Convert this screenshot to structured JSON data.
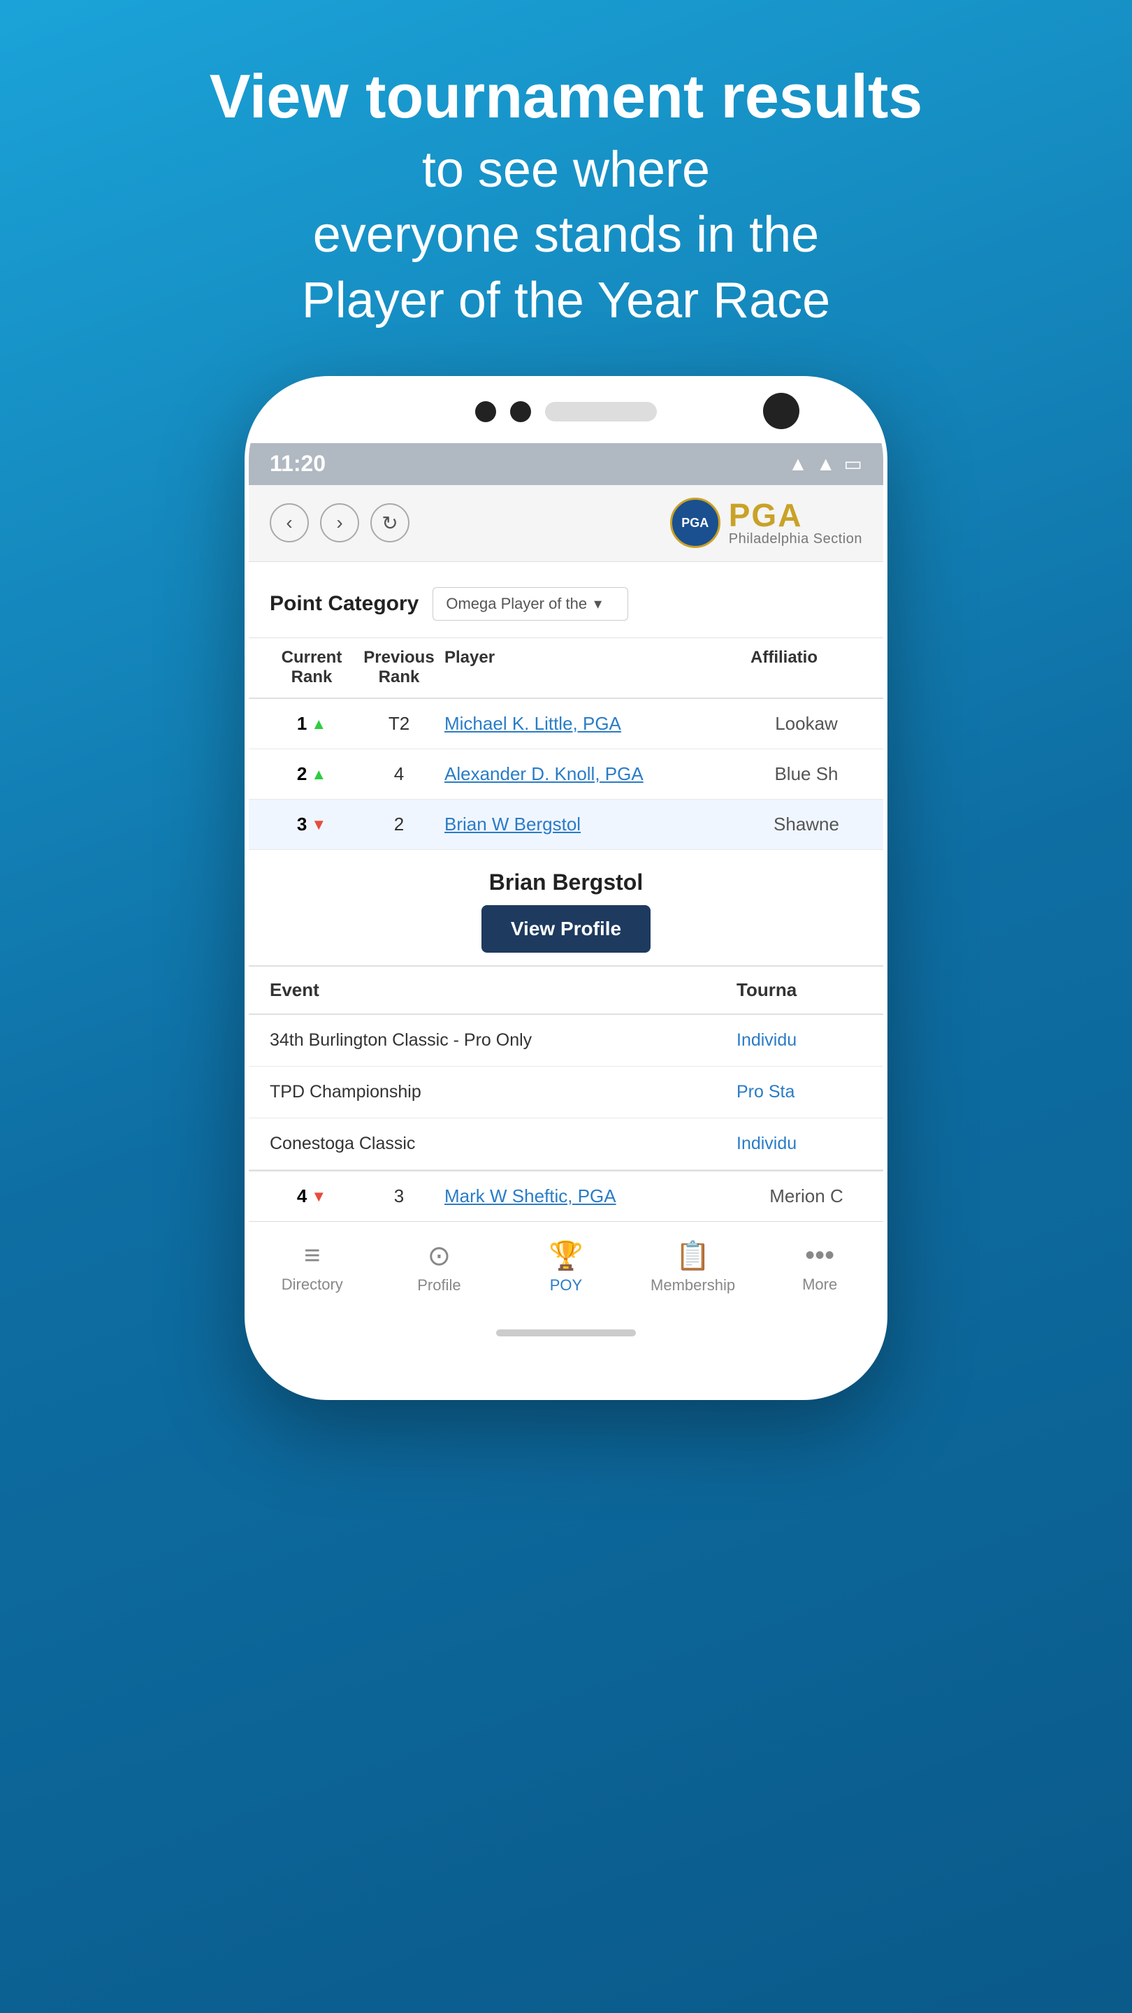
{
  "hero": {
    "line1": "View tournament results",
    "line2": "to see where",
    "line3": "everyone stands in the",
    "line4": "Player of the Year Race"
  },
  "status_bar": {
    "time": "11:20",
    "wifi": "▲",
    "signal": "▲",
    "battery": "▭"
  },
  "header": {
    "back_label": "‹",
    "forward_label": "›",
    "refresh_label": "↻",
    "pga_seal": "PGA",
    "pga_title": "PGA",
    "pga_subtitle": "Philadelphia Section"
  },
  "point_category": {
    "label": "Point Category",
    "selected": "Omega Player of the",
    "dropdown_arrow": "▾"
  },
  "table": {
    "headers": {
      "current_rank": "Current Rank",
      "previous_rank": "Previous Rank",
      "player": "Player",
      "affiliation": "Affiliatio"
    },
    "rows": [
      {
        "rank": "1",
        "trend": "up",
        "prev_rank": "T2",
        "player": "Michael K. Little, PGA",
        "affiliation": "Lookaw"
      },
      {
        "rank": "2",
        "trend": "up",
        "prev_rank": "4",
        "player": "Alexander D. Knoll, PGA",
        "affiliation": "Blue Sh"
      },
      {
        "rank": "3",
        "trend": "down",
        "prev_rank": "2",
        "player": "Brian W Bergstol",
        "affiliation": "Shawne"
      }
    ]
  },
  "selected_player": {
    "name": "Brian Bergstol",
    "view_profile_label": "View Profile"
  },
  "events_table": {
    "headers": {
      "event": "Event",
      "tournament": "Tourna"
    },
    "rows": [
      {
        "event": "34th Burlington Classic - Pro Only",
        "type": "Individu"
      },
      {
        "event": "TPD Championship",
        "type": "Pro Sta"
      },
      {
        "event": "Conestoga Classic",
        "type": "Individu"
      }
    ]
  },
  "row4": {
    "rank": "4",
    "trend": "down",
    "prev_rank": "3",
    "player": "Mark W Sheftic, PGA",
    "affiliation": "Merion C"
  },
  "bottom_nav": {
    "items": [
      {
        "icon": "≡",
        "label": "Directory",
        "active": false
      },
      {
        "icon": "👤",
        "label": "Profile",
        "active": false
      },
      {
        "icon": "🏆",
        "label": "POY",
        "active": true
      },
      {
        "icon": "📋",
        "label": "Membership",
        "active": false
      },
      {
        "icon": "•••",
        "label": "More",
        "active": false
      }
    ]
  }
}
